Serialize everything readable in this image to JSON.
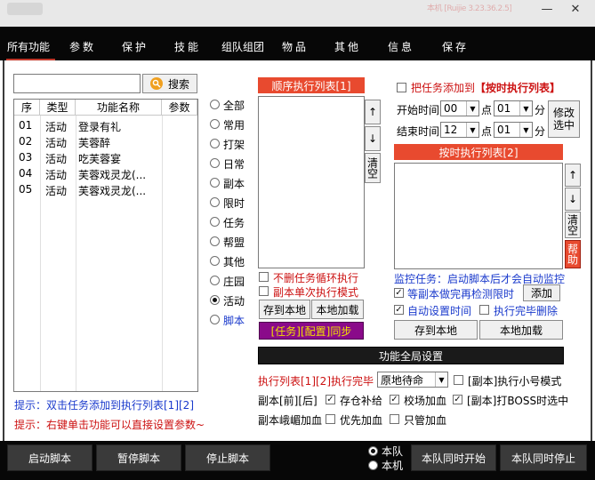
{
  "window": {
    "title_blurred": "本机 [Ruijie 3.23.36.2.5]",
    "minimize_icon": "minimize-icon",
    "close_icon": "close-icon"
  },
  "tabs": [
    {
      "label": "所有功能",
      "active": true
    },
    {
      "label": "参数"
    },
    {
      "label": "保护"
    },
    {
      "label": "技能"
    },
    {
      "label": "组队组团"
    },
    {
      "label": "物品"
    },
    {
      "label": "其他"
    },
    {
      "label": "信息"
    },
    {
      "label": "保存"
    }
  ],
  "search": {
    "value": "",
    "button_label": "搜索",
    "icon": "search-icon"
  },
  "func_table": {
    "headers": [
      "序",
      "类型",
      "功能名称",
      "参数"
    ],
    "rows": [
      {
        "no": "01",
        "type": "活动",
        "name": "登录有礼",
        "param": ""
      },
      {
        "no": "02",
        "type": "活动",
        "name": "芙蓉醉",
        "param": ""
      },
      {
        "no": "03",
        "type": "活动",
        "name": "吃芙蓉宴",
        "param": ""
      },
      {
        "no": "04",
        "type": "活动",
        "name": "芙蓉戏灵龙(...",
        "param": ""
      },
      {
        "no": "05",
        "type": "活动",
        "name": "芙蓉戏灵龙(...",
        "param": ""
      }
    ]
  },
  "categories": [
    {
      "label": "全部",
      "checked": false
    },
    {
      "label": "常用",
      "checked": false
    },
    {
      "label": "打架",
      "checked": false
    },
    {
      "label": "日常",
      "checked": false
    },
    {
      "label": "副本",
      "checked": false
    },
    {
      "label": "限时",
      "checked": false
    },
    {
      "label": "任务",
      "checked": false
    },
    {
      "label": "帮盟",
      "checked": false
    },
    {
      "label": "其他",
      "checked": false
    },
    {
      "label": "庄园",
      "checked": false
    },
    {
      "label": "活动",
      "checked": true
    },
    {
      "label": "脚本",
      "checked": false
    }
  ],
  "hints": {
    "hint1": "提示：双击任务添加到执行列表[1][2]",
    "hint2": "提示：右键单击功能可以直接设置参数~"
  },
  "seq_list": {
    "header": "顺序执行列表[1]",
    "up_label": "↑",
    "down_label": "↓",
    "clear_label": "清空",
    "no_delete_loop": "不删任务循环执行",
    "single_dungeon": "副本单次执行模式",
    "save_local": "存到本地",
    "load_local": "本地加载",
    "sync_label": "[任务][配置]同步"
  },
  "timed": {
    "add_to_timed": "把任务添加到",
    "add_to_timed_highlight": "【按时执行列表】",
    "start_time_label": "开始时间",
    "end_time_label": "结束时间",
    "start_hour": "00",
    "start_min": "01",
    "end_hour": "12",
    "end_min": "01",
    "point_label": "点",
    "minute_label": "分",
    "modify_selected": "修改选中",
    "header": "按时执行列表[2]",
    "up_label": "↑",
    "down_label": "↓",
    "clear_label": "清空",
    "help_label": "帮助",
    "monitor_text": "监控任务：启动脚本后才会自动监控",
    "wait_dungeon": "等副本做完再检测限时",
    "add_label": "添加",
    "auto_time": "自动设置时间",
    "delete_done": "执行完毕删除",
    "save_local": "存到本地",
    "load_local": "本地加载"
  },
  "global": {
    "header": "功能全局设置",
    "exec_done_prefix": "执行列表[1][2]执行完毕",
    "exec_done_value": "原地待命",
    "small_mode": "[副本]执行小号模式",
    "dungeon_prefix": "副本[前][后]",
    "store_supply": "存仓补给",
    "field_hp": "校场加血",
    "boss_select": "[副本]打BOSS时选中",
    "mountain_hp": "副本峨嵋加血",
    "priority_hp": "优先加血",
    "only_hp": "只管加血"
  },
  "bottom": {
    "start_script": "启动脚本",
    "pause_script": "暂停脚本",
    "stop_script": "停止脚本",
    "team_label": "本队",
    "machine_label": "本机",
    "team_start": "本队同时开始",
    "team_stop": "本队同时停止"
  },
  "colors": {
    "accent_red": "#e84a2f",
    "hint_blue": "#1a3acc",
    "hint_red": "#cc1111",
    "sync_purple": "#8a0a8a",
    "sync_text": "#f0e000"
  }
}
